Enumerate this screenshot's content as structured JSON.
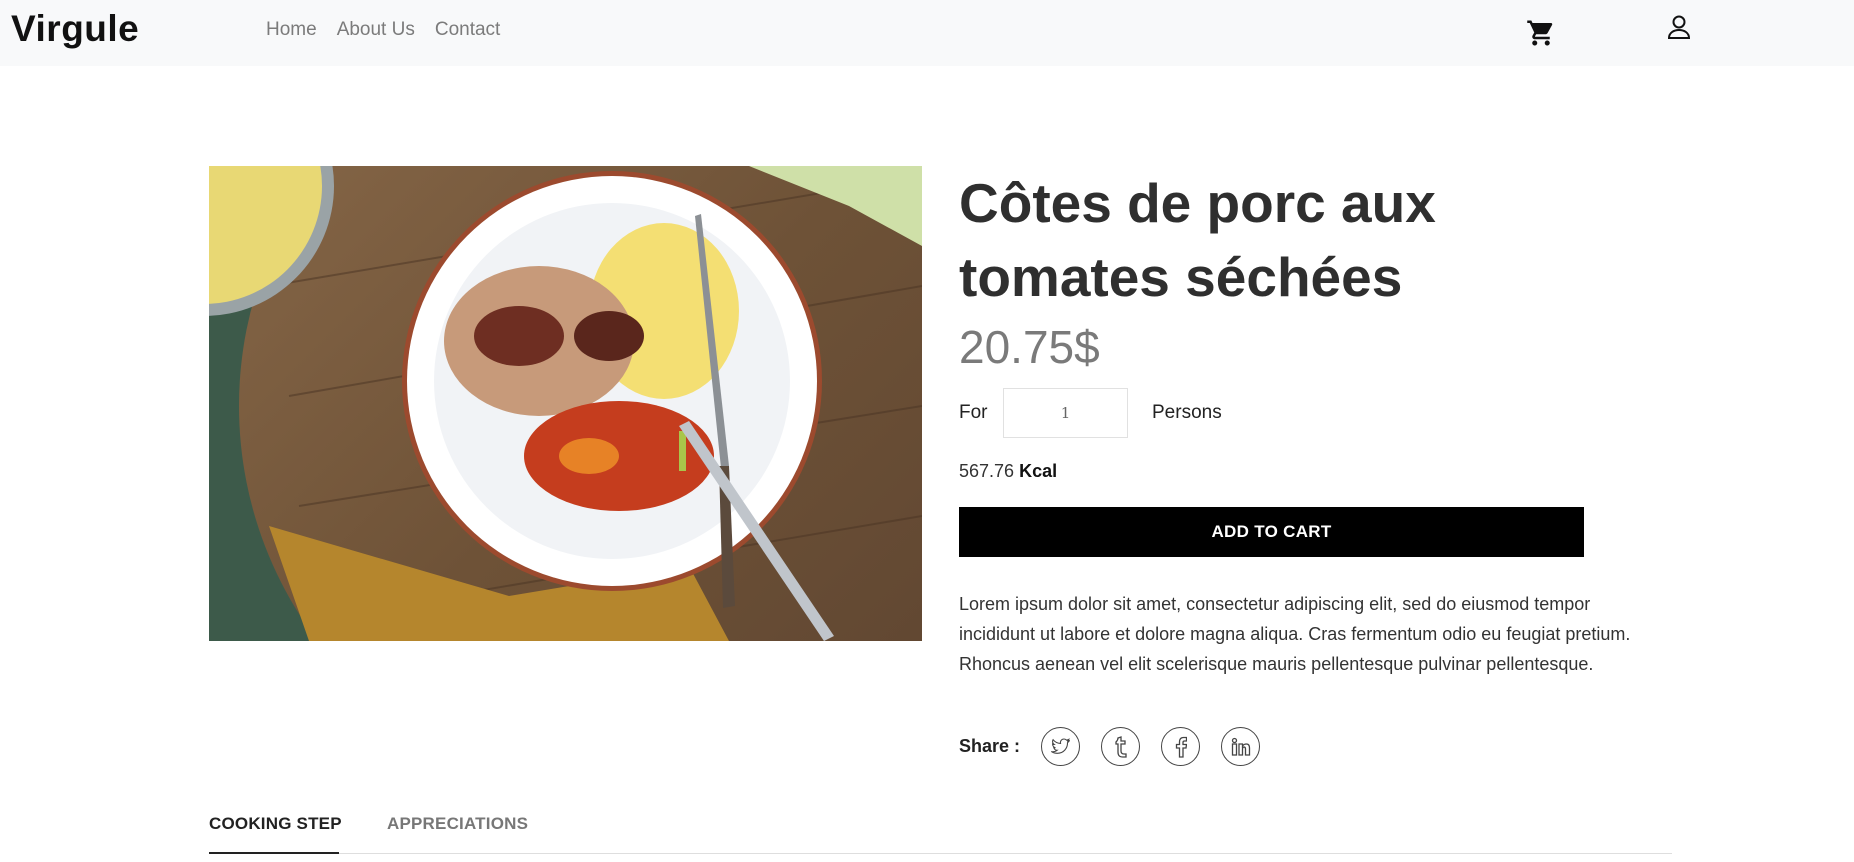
{
  "header": {
    "brand": "Virgule",
    "nav": [
      "Home",
      "About Us",
      "Contact"
    ],
    "icons": [
      "cart-icon",
      "user-icon"
    ]
  },
  "product": {
    "title": "Côtes de porc aux tomates séchées",
    "price": "20.75$",
    "for_label": "For",
    "persons_value": "1",
    "persons_label": "Persons",
    "kcal_value": "567.76",
    "kcal_unit": "Kcal",
    "add_to_cart": "ADD TO CART",
    "description": "Lorem ipsum dolor sit amet, consectetur adipiscing elit, sed do eiusmod tempor incididunt ut labore et dolore magna aliqua. Cras fermentum odio eu feugiat pretium. Rhoncus aenean vel elit scelerisque mauris pellentesque pulvinar pellentesque.",
    "share_label": "Share :",
    "share_icons": [
      "twitter-icon",
      "tumblr-icon",
      "facebook-icon",
      "linkedin-icon"
    ]
  },
  "tabs": [
    {
      "label": "COOKING STEP",
      "active": true
    },
    {
      "label": "APPRECIATIONS",
      "active": false
    }
  ],
  "colors": {
    "navbar_bg": "#f8f9fa",
    "button_bg": "#000000",
    "price": "#7a7a7a"
  }
}
